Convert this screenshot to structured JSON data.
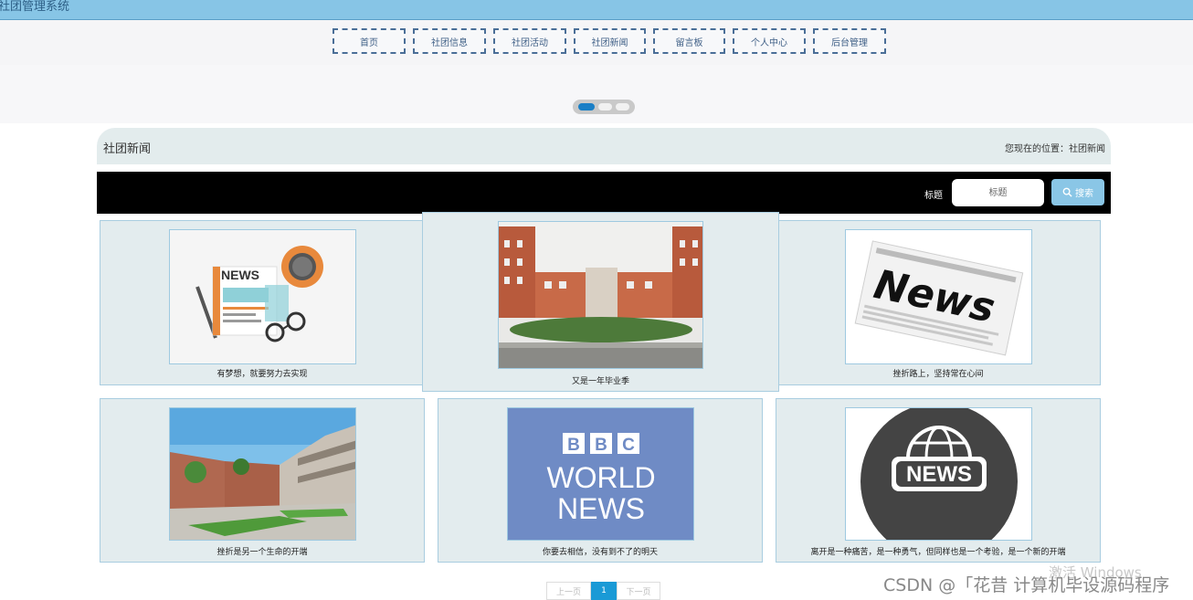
{
  "app": {
    "title": "社团管理系统"
  },
  "nav": {
    "items": [
      "首页",
      "社团信息",
      "社团活动",
      "社团新闻",
      "留言板",
      "个人中心",
      "后台管理"
    ]
  },
  "section": {
    "title": "社团新闻",
    "location_label": "您现在的位置：",
    "location_value": "社团新闻"
  },
  "search": {
    "label": "标题",
    "placeholder": "标题",
    "button_label": "搜索"
  },
  "news": [
    {
      "caption": "有梦想，就要努力去实现",
      "image": "news-illustration"
    },
    {
      "caption": "又是一年毕业季",
      "image": "campus-photo"
    },
    {
      "caption": "挫折路上，坚持常在心间",
      "image": "newspaper-photo"
    },
    {
      "caption": "挫折是另一个生命的开端",
      "image": "campus-building-photo"
    },
    {
      "caption": "你要去相信，没有到不了的明天",
      "image": "bbc-world-news-logo"
    },
    {
      "caption": "离开是一种痛苦，是一种勇气，但同样也是一个考验，是一个新的开端",
      "image": "news-globe-icon"
    }
  ],
  "bbc": {
    "line1": "BBC",
    "line2": "WORLD",
    "line3": "NEWS"
  },
  "news_icon_text": "NEWS",
  "newspaper_text": "News",
  "pagination": {
    "prev": "上一页",
    "current": "1",
    "next": "下一页"
  },
  "watermarks": {
    "windows": "激活 Windows",
    "csdn": "CSDN @「花昔  计算机毕设源码程序"
  },
  "colors": {
    "header": "#87c5e6",
    "nav_border": "#4a6e97",
    "card_bg": "#e3ecee",
    "search_button": "#8ac6e6",
    "page_active": "#1a9ad6",
    "carousel_active": "#1a7fc6"
  }
}
